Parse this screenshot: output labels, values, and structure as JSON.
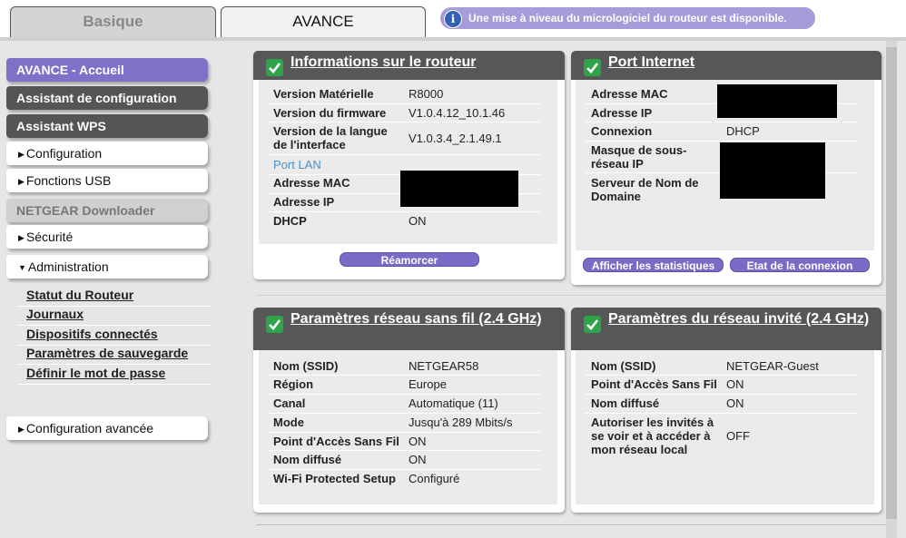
{
  "tabs": {
    "basic": "Basique",
    "advanced": "AVANCE"
  },
  "notice": {
    "text": "Une mise à niveau du micrologiciel du routeur est disponible.",
    "icon": "info-icon"
  },
  "sidebar": {
    "items": [
      {
        "label": "AVANCE - Accueil"
      },
      {
        "label": "Assistant de configuration"
      },
      {
        "label": "Assistant WPS"
      },
      {
        "label": "Configuration"
      },
      {
        "label": "Fonctions USB"
      },
      {
        "label": "NETGEAR Downloader"
      },
      {
        "label": "Sécurité"
      },
      {
        "label": "Administration"
      },
      {
        "label": "Configuration avancée"
      }
    ],
    "admin_links": [
      {
        "label": "Statut du Routeur"
      },
      {
        "label": "Journaux"
      },
      {
        "label": "Dispositifs connectés"
      },
      {
        "label": "Paramètres de sauvegarde"
      },
      {
        "label": "Définir le mot de passe"
      }
    ]
  },
  "router_info": {
    "title": "Informations sur le routeur",
    "rows": [
      {
        "label": "Version Matérielle",
        "value": "R8000"
      },
      {
        "label": "Version du firmware",
        "value": "V1.0.4.12_10.1.46"
      },
      {
        "label": "Version de la langue de l'interface",
        "value": "V1.0.3.4_2.1.49.1"
      },
      {
        "label": "Port LAN",
        "value": ""
      },
      {
        "label": "Adresse MAC",
        "value": ""
      },
      {
        "label": "Adresse IP",
        "value": ""
      },
      {
        "label": "DHCP",
        "value": "ON"
      }
    ],
    "button": "Réamorcer"
  },
  "internet_port": {
    "title": "Port Internet",
    "rows": [
      {
        "label": "Adresse MAC",
        "value": ""
      },
      {
        "label": "Adresse IP",
        "value": ""
      },
      {
        "label": "Connexion",
        "value": "DHCP"
      },
      {
        "label": "Masque de sous-réseau IP",
        "value": ""
      },
      {
        "label": "Serveur de Nom de Domaine",
        "value": ""
      }
    ],
    "buttons": [
      "Afficher les statistiques",
      "Etat de la connexion"
    ]
  },
  "wireless": {
    "title": "Paramètres réseau sans fil (2.4 GHz)",
    "rows": [
      {
        "label": "Nom (SSID)",
        "value": "NETGEAR58"
      },
      {
        "label": "Région",
        "value": "Europe"
      },
      {
        "label": "Canal",
        "value": "Automatique (11)"
      },
      {
        "label": "Mode",
        "value": "Jusqu'à 289 Mbits/s"
      },
      {
        "label": "Point d'Accès Sans Fil",
        "value": "ON"
      },
      {
        "label": "Nom diffusé",
        "value": "ON"
      },
      {
        "label": "Wi-Fi Protected Setup",
        "value": "Configuré"
      }
    ]
  },
  "guest": {
    "title": "Paramètres du réseau invité (2.4 GHz)",
    "rows": [
      {
        "label": "Nom (SSID)",
        "value": "NETGEAR-Guest"
      },
      {
        "label": "Point d'Accès Sans Fil",
        "value": "ON"
      },
      {
        "label": "Nom diffusé",
        "value": "ON"
      },
      {
        "label": "Autoriser les invités à se voir et à accéder à mon réseau local",
        "value": "OFF"
      }
    ]
  },
  "colors": {
    "accent": "#8070c8",
    "header": "#575757",
    "check": "#2fa34a"
  }
}
